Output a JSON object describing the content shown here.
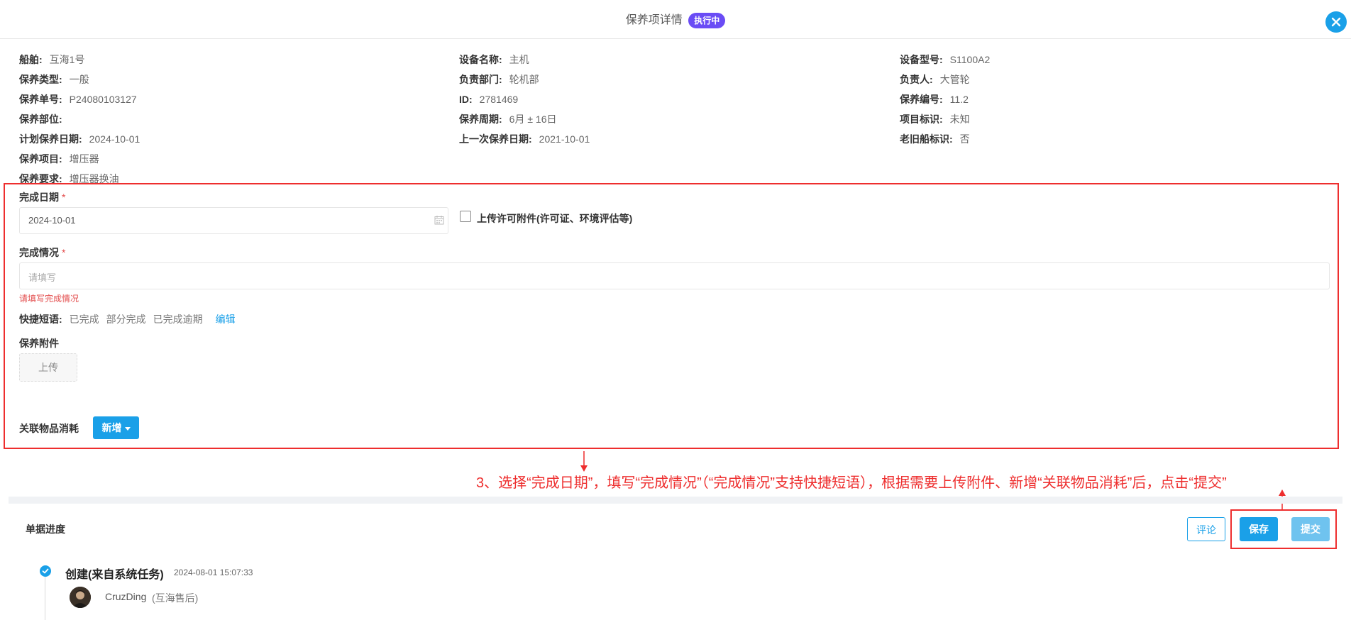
{
  "header": {
    "title": "保养项详情",
    "status_badge": "执行中"
  },
  "info": {
    "col1": [
      {
        "label": "船舶:",
        "value": "互海1号"
      },
      {
        "label": "保养类型:",
        "value": "一般"
      },
      {
        "label": "保养单号:",
        "value": "P24080103127"
      },
      {
        "label": "保养部位:",
        "value": ""
      },
      {
        "label": "计划保养日期:",
        "value": "2024-10-01"
      },
      {
        "label": "保养项目:",
        "value": "增压器"
      },
      {
        "label": "保养要求:",
        "value": "增压器换油"
      }
    ],
    "col2": [
      {
        "label": "设备名称:",
        "value": "主机"
      },
      {
        "label": "负责部门:",
        "value": "轮机部"
      },
      {
        "label": "ID:",
        "value": "2781469"
      },
      {
        "label": "保养周期:",
        "value": "6月 ± 16日"
      },
      {
        "label": "上一次保养日期:",
        "value": "2021-10-01"
      }
    ],
    "col3": [
      {
        "label": "设备型号:",
        "value": "S1100A2"
      },
      {
        "label": "负责人:",
        "value": "大管轮"
      },
      {
        "label": "保养编号:",
        "value": "11.2"
      },
      {
        "label": "项目标识:",
        "value": "未知"
      },
      {
        "label": "老旧船标识:",
        "value": "否"
      }
    ]
  },
  "form": {
    "completion_date_label": "完成日期",
    "required_mark": "*",
    "completion_date_value": "2024-10-01",
    "permit_checkbox_label": "上传许可附件(许可证、环境评估等)",
    "completion_status_label": "完成情况",
    "completion_status_placeholder": "请填写",
    "completion_status_error": "请填写完成情况",
    "quick_phrases_label": "快捷短语:",
    "quick_phrases": [
      "已完成",
      "部分完成",
      "已完成逾期"
    ],
    "quick_phrases_edit": "编辑",
    "attachment_label": "保养附件",
    "upload_button": "上传",
    "related_items_label": "关联物品消耗",
    "add_button": "新增"
  },
  "annotation": {
    "text": "3、选择“完成日期”，填写“完成情况”（“完成情况”支持快捷短语），根据需要上传附件、新增“关联物品消耗”后，点击“提交”",
    "color": "#ee2e2e"
  },
  "progress": {
    "title": "单据进度",
    "comment_button": "评论",
    "save_button": "保存",
    "submit_button": "提交",
    "timeline": [
      {
        "title": "创建(来自系统任务)",
        "time": "2024-08-01 15:07:33",
        "user": "CruzDing",
        "org": "(互海售后)"
      }
    ]
  },
  "colors": {
    "accent": "#1aa0e8",
    "badge": "#6a4cf5",
    "error": "#e34d4d"
  }
}
